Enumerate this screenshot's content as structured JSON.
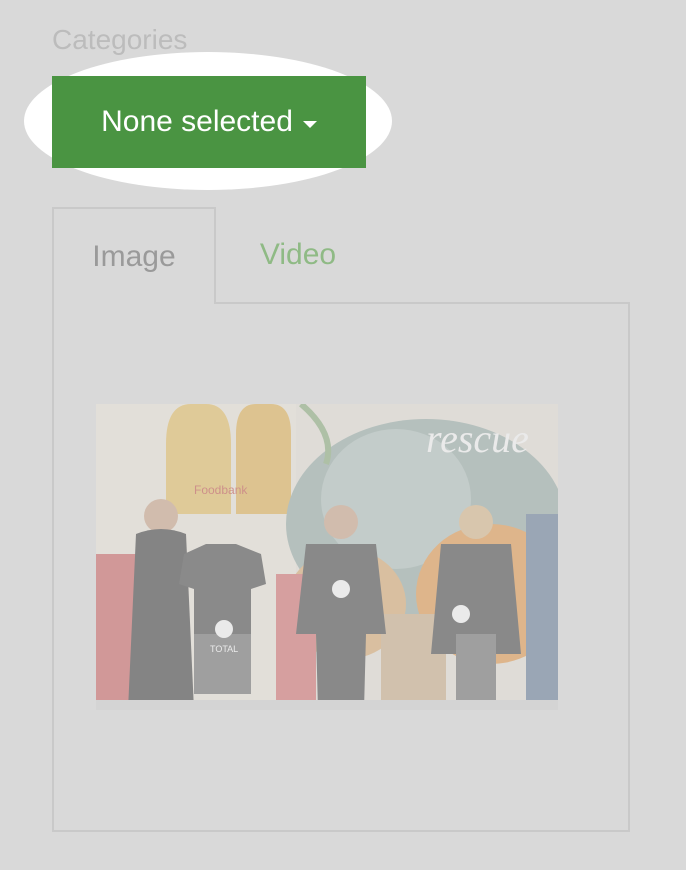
{
  "categories": {
    "label": "Categories",
    "dropdown_label": "None selected",
    "accent_color": "#4a9442"
  },
  "tabs": [
    {
      "label": "Image",
      "active": true
    },
    {
      "label": "Video",
      "active": false
    }
  ],
  "photo_text": {
    "left_banner": "Foodbank",
    "mural_script": "rescue",
    "shirt_brand": "TOTAL"
  }
}
